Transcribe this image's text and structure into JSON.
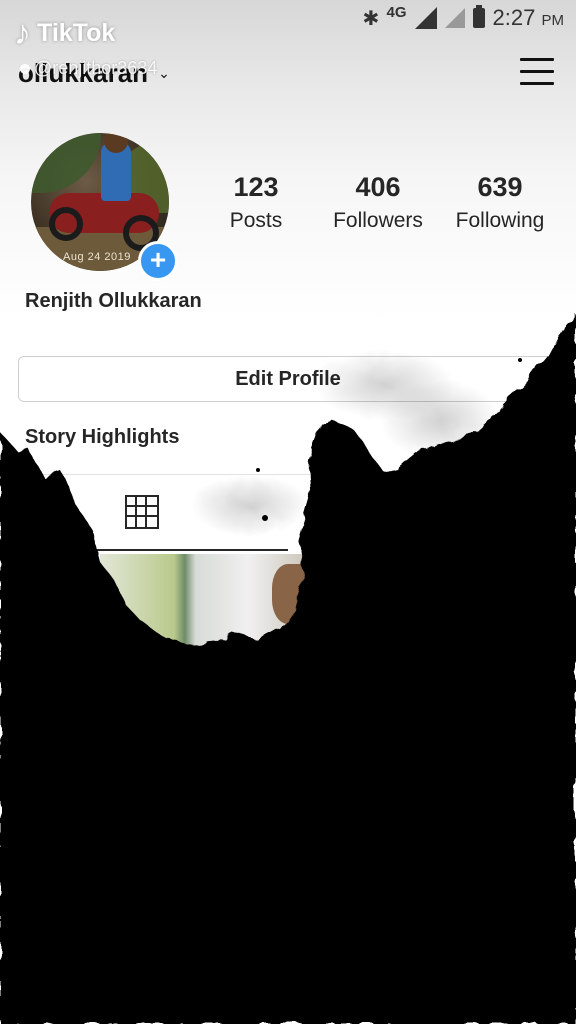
{
  "status_bar": {
    "bluetooth_icon": "bluetooth-icon",
    "network": "4G",
    "time": "2:27",
    "ampm": "PM"
  },
  "tiktok": {
    "logo_text": "TikTok",
    "handle": "@renjithor3634"
  },
  "header": {
    "username": "ollukkaran"
  },
  "profile": {
    "avatar_stamp": "Aug 24 2019",
    "name": "Renjith Ollukkaran",
    "stats": [
      {
        "value": "123",
        "label": "Posts"
      },
      {
        "value": "406",
        "label": "Followers"
      },
      {
        "value": "639",
        "label": "Following"
      }
    ],
    "edit_button": "Edit Profile",
    "story_highlights": "Story Highlights"
  },
  "colors": {
    "accent": "#3897f0",
    "text": "#262626",
    "smudge": "#000000"
  }
}
